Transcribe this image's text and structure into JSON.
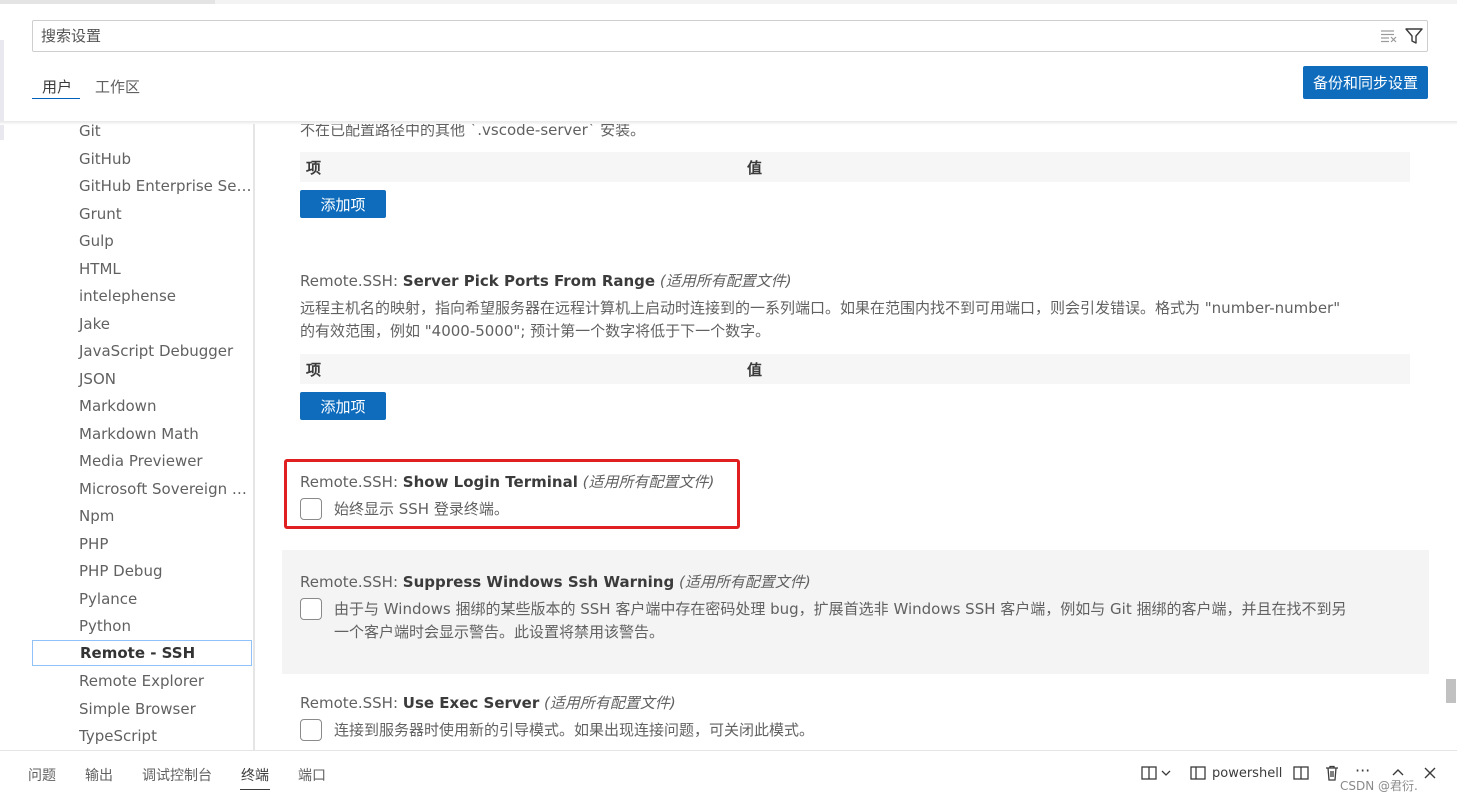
{
  "search": {
    "placeholder": "搜索设置"
  },
  "scope_tabs": [
    "用户",
    "工作区"
  ],
  "sync_button": "备份和同步设置",
  "toc": [
    "Git",
    "GitHub",
    "GitHub Enterprise Server",
    "Grunt",
    "Gulp",
    "HTML",
    "intelephense",
    "Jake",
    "JavaScript Debugger",
    "JSON",
    "Markdown",
    "Markdown Math",
    "Media Previewer",
    "Microsoft Sovereign Cloud",
    "Npm",
    "PHP",
    "PHP Debug",
    "Pylance",
    "Python",
    "Remote - SSH",
    "Remote Explorer",
    "Simple Browser",
    "TypeScript"
  ],
  "toc_selected": "Remote - SSH",
  "settings": {
    "prev_desc": "不在已配置路径中的其他 `.vscode-server` 安装。",
    "kv_item": "项",
    "kv_value": "值",
    "add_item": "添加项",
    "pick_ports": {
      "category": "Remote.SSH: ",
      "key": "Server Pick Ports From Range",
      "scope": "(适用所有配置文件)",
      "desc1": "远程主机名的映射，指向希望服务器在远程计算机上启动时连接到的一系列端口。如果在范围内找不到可用端口，则会引发错误。格式为 \"number-number\"",
      "desc2": "的有效范围，例如 \"4000-5000\"; 预计第一个数字将低于下一个数字。"
    },
    "show_login": {
      "category": "Remote.SSH: ",
      "key": "Show Login Terminal",
      "scope": "(适用所有配置文件)",
      "desc": "始终显示 SSH 登录终端。",
      "checked": false
    },
    "suppress_warning": {
      "category": "Remote.SSH: ",
      "key": "Suppress Windows Ssh Warning",
      "scope": "(适用所有配置文件)",
      "desc1": "由于与 Windows 捆绑的某些版本的 SSH 客户端中存在密码处理 bug，扩展首选非 Windows SSH 客户端，例如与 Git 捆绑的客户端，并且在找不到另",
      "desc2": "一个客户端时会显示警告。此设置将禁用该警告。",
      "checked": false
    },
    "exec_server": {
      "category": "Remote.SSH: ",
      "key": "Use Exec Server",
      "scope": "(适用所有配置文件)",
      "desc": "连接到服务器时使用新的引导模式。如果出现连接问题，可关闭此模式。",
      "checked": false
    }
  },
  "panel": {
    "tabs": [
      "问题",
      "输出",
      "调试控制台",
      "终端",
      "端口"
    ],
    "active": "终端",
    "terminal": "powershell",
    "more": "···"
  },
  "watermark": "CSDN @君衍."
}
